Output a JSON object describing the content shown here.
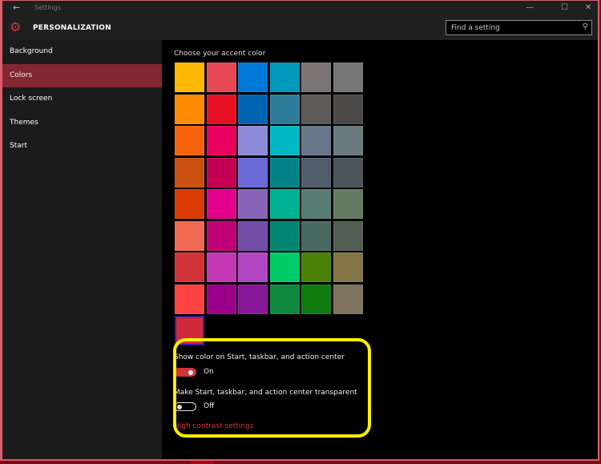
{
  "window": {
    "title": "Settings",
    "back_icon": "←",
    "minimize_icon": "—",
    "maximize_icon": "☐",
    "close_icon": "✕"
  },
  "header": {
    "app_icon": "⚙",
    "app_name": "PERSONALIZATION",
    "search": {
      "placeholder": "Find a setting",
      "value": "",
      "icon": "⚲"
    }
  },
  "sidebar": {
    "items": [
      {
        "label": "Background",
        "active": false
      },
      {
        "label": "Colors",
        "active": true
      },
      {
        "label": "Lock screen",
        "active": false
      },
      {
        "label": "Themes",
        "active": false
      },
      {
        "label": "Start",
        "active": false
      }
    ]
  },
  "main": {
    "accent_title": "Choose your accent color",
    "swatches": [
      "#ffb900",
      "#e74856",
      "#0078d7",
      "#0099bc",
      "#7a7574",
      "#767676",
      "#ff8c00",
      "#e81123",
      "#0063b1",
      "#2d7d9a",
      "#5d5a58",
      "#4c4a48",
      "#f7630c",
      "#ea005e",
      "#8e8cd8",
      "#00b7c3",
      "#68768a",
      "#69797e",
      "#ca5010",
      "#c30052",
      "#6b69d6",
      "#038387",
      "#515c6b",
      "#4a5459",
      "#da3b01",
      "#e3008c",
      "#8764b8",
      "#00b294",
      "#567c73",
      "#647c64",
      "#ef6950",
      "#bf0077",
      "#744da9",
      "#018574",
      "#486860",
      "#525e54",
      "#d13438",
      "#c239b3",
      "#b146c2",
      "#00cc6a",
      "#498205",
      "#847545",
      "#ff4343",
      "#9a0089",
      "#881798",
      "#10893e",
      "#107c10",
      "#7e735f",
      "#d02a3a"
    ],
    "selected_swatch_index": 48,
    "show_color": {
      "label": "Show color on Start, taskbar, and action center",
      "state": "On",
      "on": true
    },
    "transparent": {
      "label": "Make Start, taskbar, and action center transparent",
      "state": "Off",
      "on": false
    },
    "high_contrast_link": "High contrast settings"
  },
  "colors": {
    "accent": "#d1343f",
    "highlight": "#ffef00",
    "active_nav": "#832731"
  }
}
